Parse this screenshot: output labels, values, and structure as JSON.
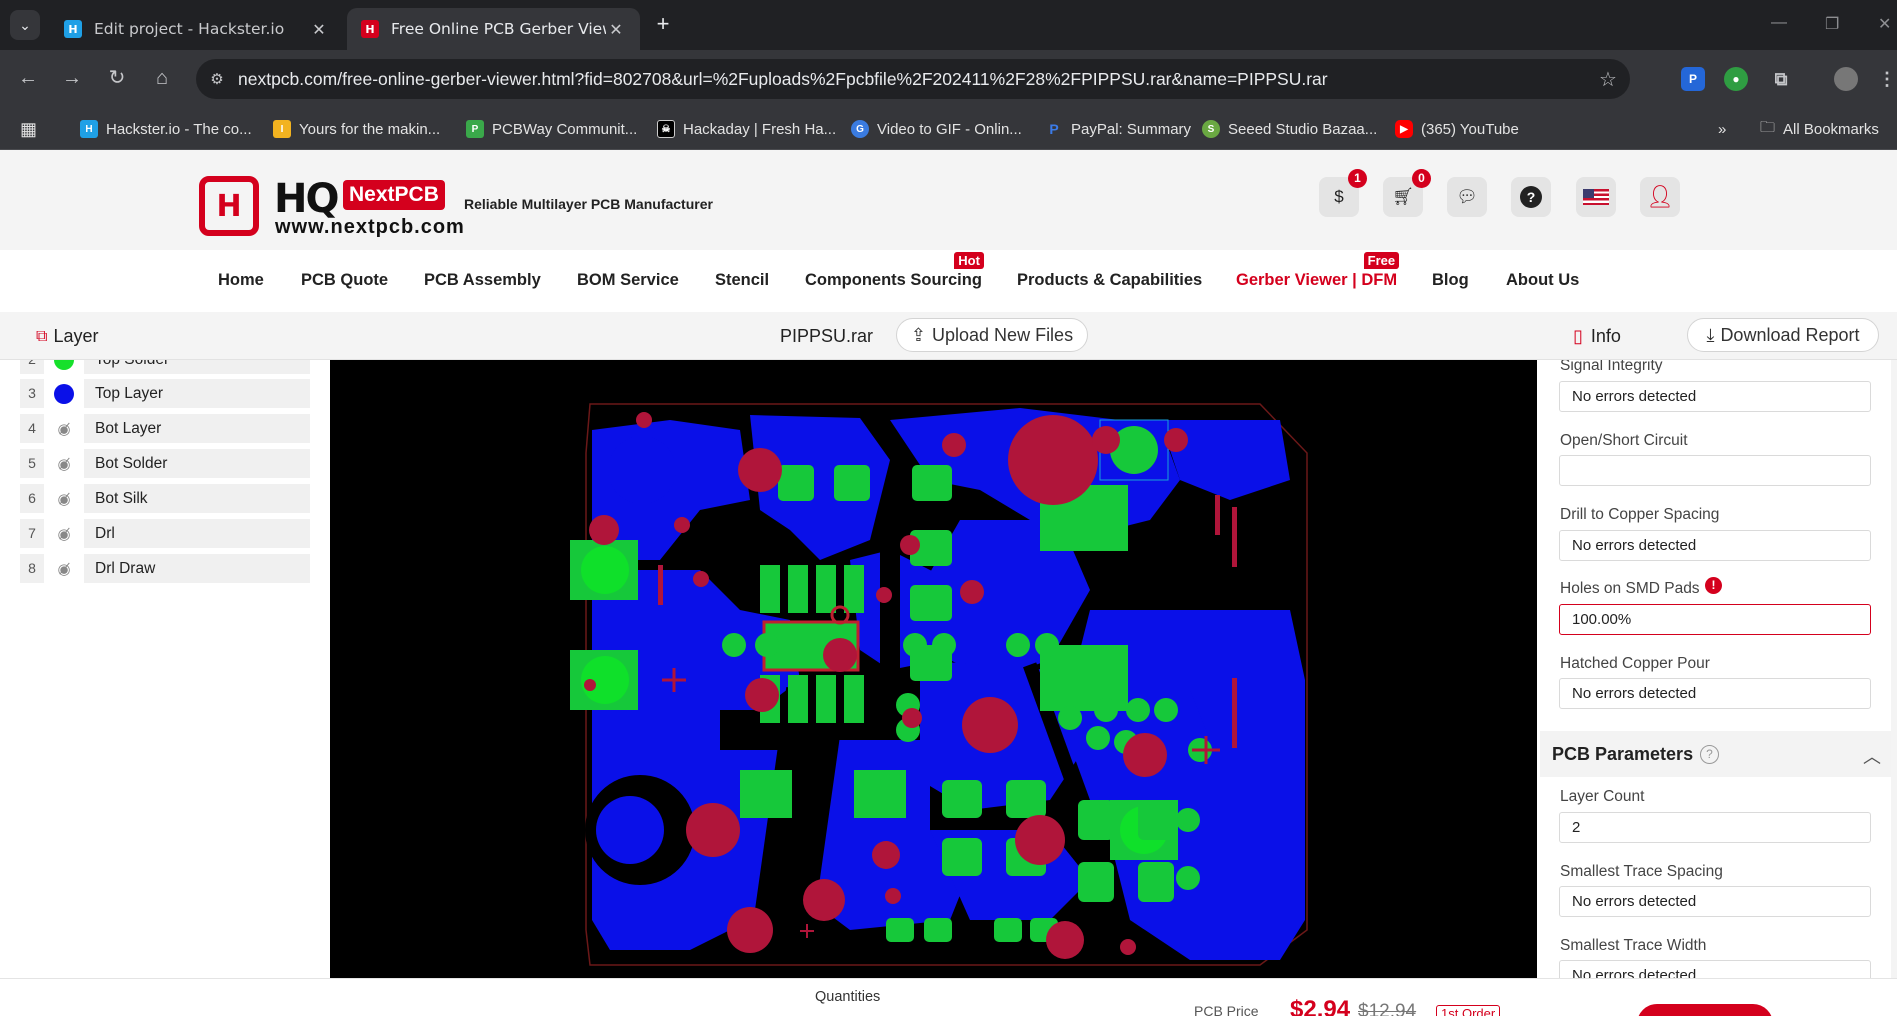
{
  "browser": {
    "tabs": [
      {
        "title": "Edit project - Hackster.io",
        "favicon": "hackster-icon",
        "color": "#1fa0e6"
      },
      {
        "title": "Free Online PCB Gerber Viewer",
        "favicon": "nextpcb-icon",
        "color": "#d4001d"
      }
    ],
    "url": "nextpcb.com/free-online-gerber-viewer.html?fid=802708&url=%2Fuploads%2Fpcbfile%2F202411%2F28%2FPIPPSU.rar&name=PIPPSU.rar",
    "bookmarks": [
      {
        "label": "Hackster.io - The co...",
        "icon": "hackster-icon",
        "color": "#1fa0e6"
      },
      {
        "label": "Yours for the makin...",
        "icon": "instructables-icon",
        "color": "#f2b320"
      },
      {
        "label": "PCBWay Communit...",
        "icon": "pcbway-icon",
        "color": "#3aa84a"
      },
      {
        "label": "Hackaday | Fresh Ha...",
        "icon": "hackaday-icon",
        "color": "#000000"
      },
      {
        "label": "Video to GIF - Onlin...",
        "icon": "ezgif-icon",
        "color": "#3a7be0"
      },
      {
        "label": "PayPal: Summary",
        "icon": "paypal-icon",
        "color": "#1b4aa0"
      },
      {
        "label": "Seeed Studio Bazaa...",
        "icon": "seeed-icon",
        "color": "#6aa842"
      },
      {
        "label": "(365) YouTube",
        "icon": "youtube-icon",
        "color": "#ff0000"
      }
    ],
    "all_bookmarks": "All Bookmarks"
  },
  "header": {
    "brand": "NextPCB",
    "hq": "HQ",
    "site_url": "www.nextpcb.com",
    "tagline": "Reliable Multilayer PCB Manufacturer",
    "coupon_count": "1",
    "cart_count": "0"
  },
  "nav": [
    {
      "label": "Home"
    },
    {
      "label": "PCB Quote"
    },
    {
      "label": "PCB Assembly"
    },
    {
      "label": "BOM Service"
    },
    {
      "label": "Stencil"
    },
    {
      "label": "Components Sourcing",
      "tag": "Hot"
    },
    {
      "label": "Products & Capabilities"
    },
    {
      "label": "Gerber Viewer | DFM",
      "tag": "Free",
      "current": true
    },
    {
      "label": "Blog"
    },
    {
      "label": "About Us"
    }
  ],
  "viewer": {
    "layer_title": "Layer",
    "file_name": "PIPPSU.rar",
    "upload_label": "Upload New Files",
    "info_title": "Info",
    "download_label": "Download Report"
  },
  "layers": [
    {
      "num": "2",
      "name": "Top Solder",
      "visible": true,
      "color": "#16e02b"
    },
    {
      "num": "3",
      "name": "Top Layer",
      "visible": true,
      "color": "#0a10e8"
    },
    {
      "num": "4",
      "name": "Bot Layer",
      "visible": false
    },
    {
      "num": "5",
      "name": "Bot Solder",
      "visible": false
    },
    {
      "num": "6",
      "name": "Bot Silk",
      "visible": false
    },
    {
      "num": "7",
      "name": "Drl",
      "visible": false
    },
    {
      "num": "8",
      "name": "Drl Draw",
      "visible": false
    }
  ],
  "dfm": {
    "checks": [
      {
        "label": "Signal Integrity",
        "value": "No errors detected"
      },
      {
        "label": "Open/Short Circuit",
        "value": ""
      },
      {
        "label": "Drill to Copper Spacing",
        "value": "No errors detected"
      },
      {
        "label": "Holes on SMD Pads",
        "value": "100.00%",
        "error": true
      },
      {
        "label": "Hatched Copper Pour",
        "value": "No errors detected"
      }
    ],
    "params_title": "PCB Parameters",
    "params": [
      {
        "label": "Layer Count",
        "value": "2"
      },
      {
        "label": "Smallest Trace Spacing",
        "value": "No errors detected"
      },
      {
        "label": "Smallest Trace Width",
        "value": "No errors detected"
      }
    ]
  },
  "bottom": {
    "quantities_label": "Quantities",
    "price_label": "PCB Price",
    "price": "$2.94",
    "old_price": "$12.94",
    "first_order": "1st Order"
  },
  "colors": {
    "brand_red": "#d4001d",
    "copper_blue": "#0a10e8",
    "solder_green": "#16c83a",
    "drill_red": "#b0153a"
  }
}
